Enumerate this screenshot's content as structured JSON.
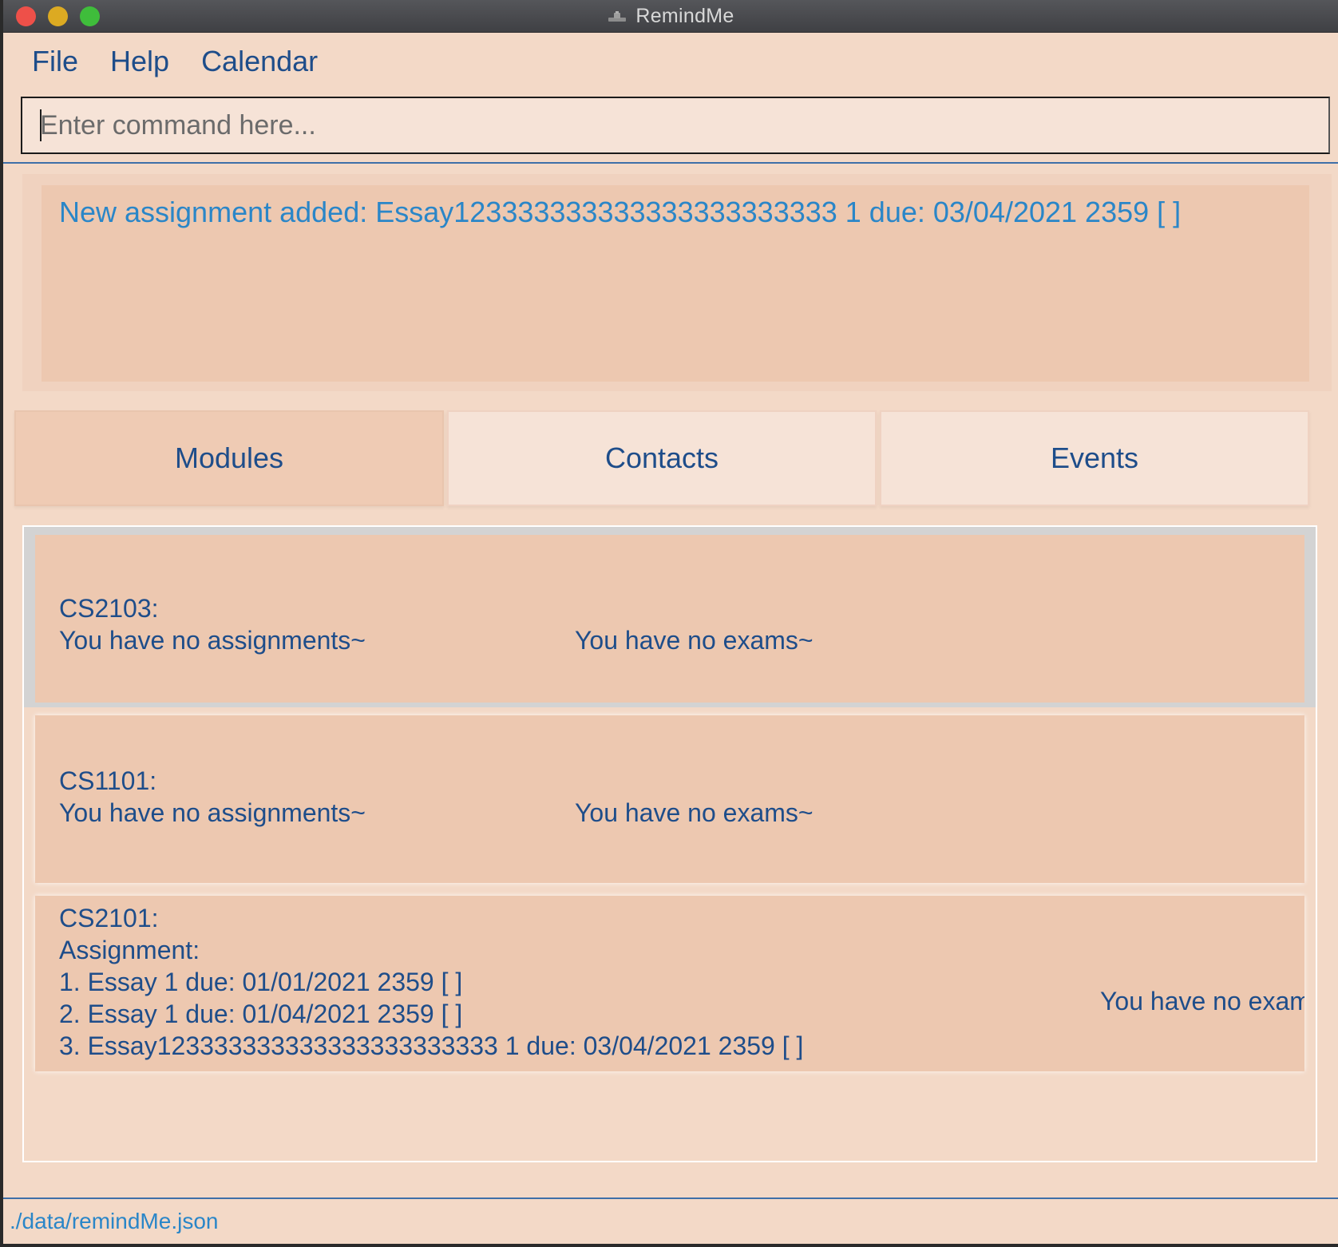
{
  "window": {
    "title": "RemindMe",
    "app_icon": "remindme-app-icon"
  },
  "menu": {
    "items": [
      "File",
      "Help",
      "Calendar"
    ]
  },
  "command": {
    "placeholder": "Enter command here...",
    "value": ""
  },
  "result": {
    "message": "New assignment added: Essay123333333333333333333333 1 due: 03/04/2021 2359    [ ]"
  },
  "tabs": [
    {
      "label": "Modules",
      "active": true
    },
    {
      "label": "Contacts",
      "active": false
    },
    {
      "label": "Events",
      "active": false
    }
  ],
  "modules": [
    {
      "code": "CS2103:",
      "assignments_text": "You have no assignments~",
      "exams_text": "You have no exams~",
      "selected": true
    },
    {
      "code": "CS1101:",
      "assignments_text": "You have no assignments~",
      "exams_text": "You have no exams~",
      "selected": false
    },
    {
      "code": "CS2101:",
      "assignments_header": "Assignment:",
      "assignments": [
        "1. Essay 1 due: 01/01/2021 2359    [ ]",
        "2. Essay 1 due: 01/04/2021 2359    [ ]",
        "3. Essay123333333333333333333333 1 due: 03/04/2021 2359    [ ]"
      ],
      "exams_text": "You have no exams",
      "selected": false
    }
  ],
  "status": {
    "file_path": "./data/remindMe.json"
  },
  "colors": {
    "background": "#f3d9c7",
    "card": "#edc8b0",
    "text_dark_blue": "#1e4d8a",
    "text_light_blue": "#2a86c8"
  }
}
